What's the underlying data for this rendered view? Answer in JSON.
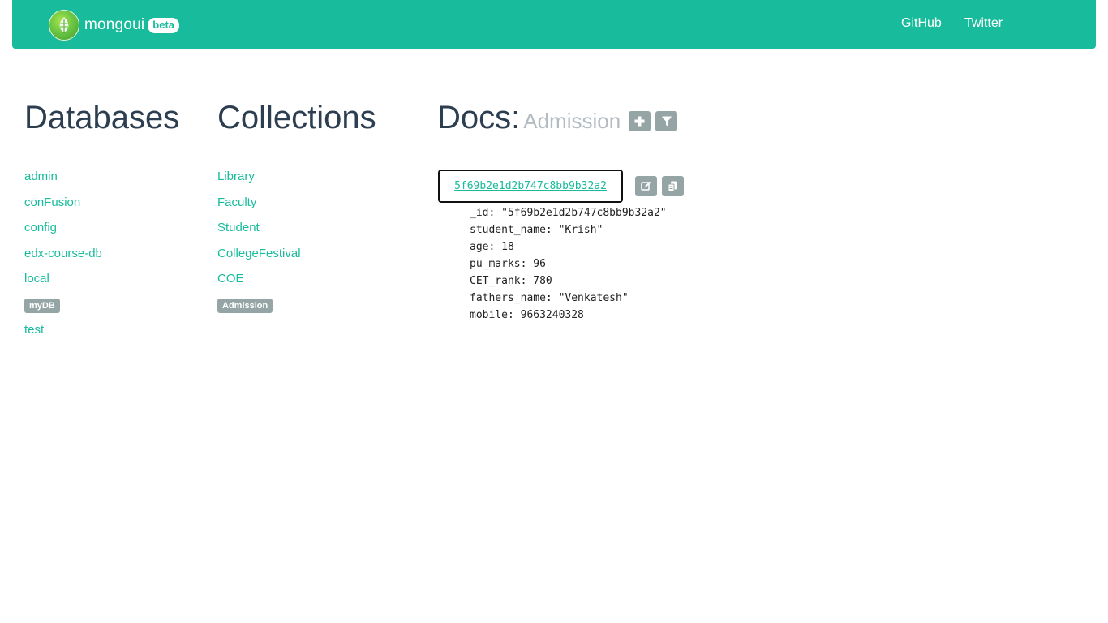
{
  "navbar": {
    "brand": "mongoui",
    "badge": "beta",
    "links": [
      "GitHub",
      "Twitter"
    ]
  },
  "databases": {
    "heading": "Databases",
    "items": [
      "admin",
      "conFusion",
      "config",
      "edx-course-db",
      "local",
      "myDB",
      "test"
    ],
    "active": "myDB"
  },
  "collections": {
    "heading": "Collections",
    "items": [
      "Library",
      "Faculty",
      "Student",
      "CollegeFestival",
      "COE",
      "Admission"
    ],
    "active": "Admission"
  },
  "docs": {
    "heading": "Docs:",
    "collection": "Admission",
    "document": {
      "id": "5f69b2e1d2b747c8bb9b32a2",
      "fields": [
        "_id: \"5f69b2e1d2b747c8bb9b32a2\"",
        "student_name: \"Krish\"",
        "age: 18",
        "pu_marks: 96",
        "CET_rank: 780",
        "fathers_name: \"Venkatesh\"",
        "mobile: 9663240328"
      ]
    }
  },
  "icons": {
    "add": "plus-icon",
    "filter": "filter-icon",
    "edit": "edit-icon",
    "copy": "clipboard-icon"
  },
  "colors": {
    "primary": "#18bc9c",
    "text": "#2c3e50",
    "muted": "#b4bcc2",
    "label": "#95a5a6"
  }
}
